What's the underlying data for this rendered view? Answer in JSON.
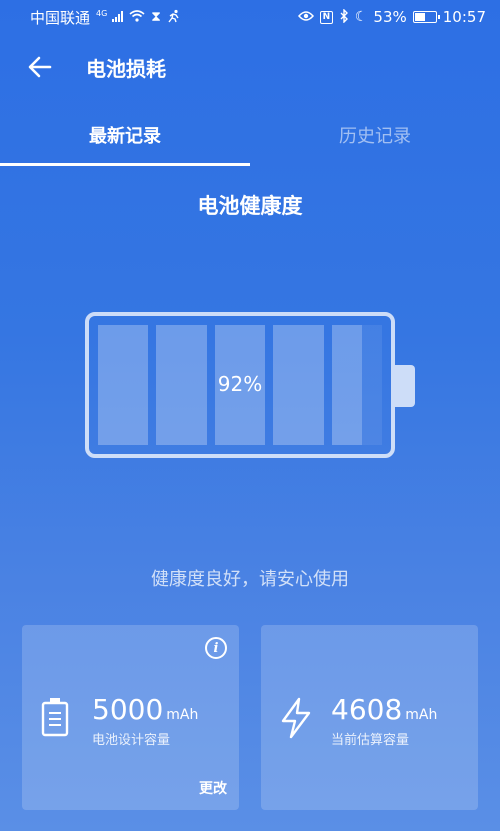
{
  "status_bar": {
    "carrier": "中国联通",
    "network_type": "4G",
    "battery_percent": "53%",
    "battery_level": 0.53,
    "time": "10:57",
    "icons": [
      "signal-icon",
      "wifi-icon",
      "hourglass-icon",
      "running-icon",
      "eye-icon",
      "nfc-icon",
      "bluetooth-icon",
      "moon-icon",
      "battery-icon"
    ]
  },
  "app_bar": {
    "title": "电池损耗"
  },
  "tabs": [
    {
      "label": "最新记录",
      "active": true
    },
    {
      "label": "历史记录",
      "active": false
    }
  ],
  "health": {
    "title": "电池健康度",
    "percent": "92%",
    "value": 0.92,
    "message": "健康度良好，请安心使用"
  },
  "cards": {
    "design_capacity": {
      "value": "5000",
      "unit": "mAh",
      "label": "电池设计容量",
      "action": "更改",
      "info": "i"
    },
    "estimated_capacity": {
      "value": "4608",
      "unit": "mAh",
      "label": "当前估算容量"
    }
  }
}
